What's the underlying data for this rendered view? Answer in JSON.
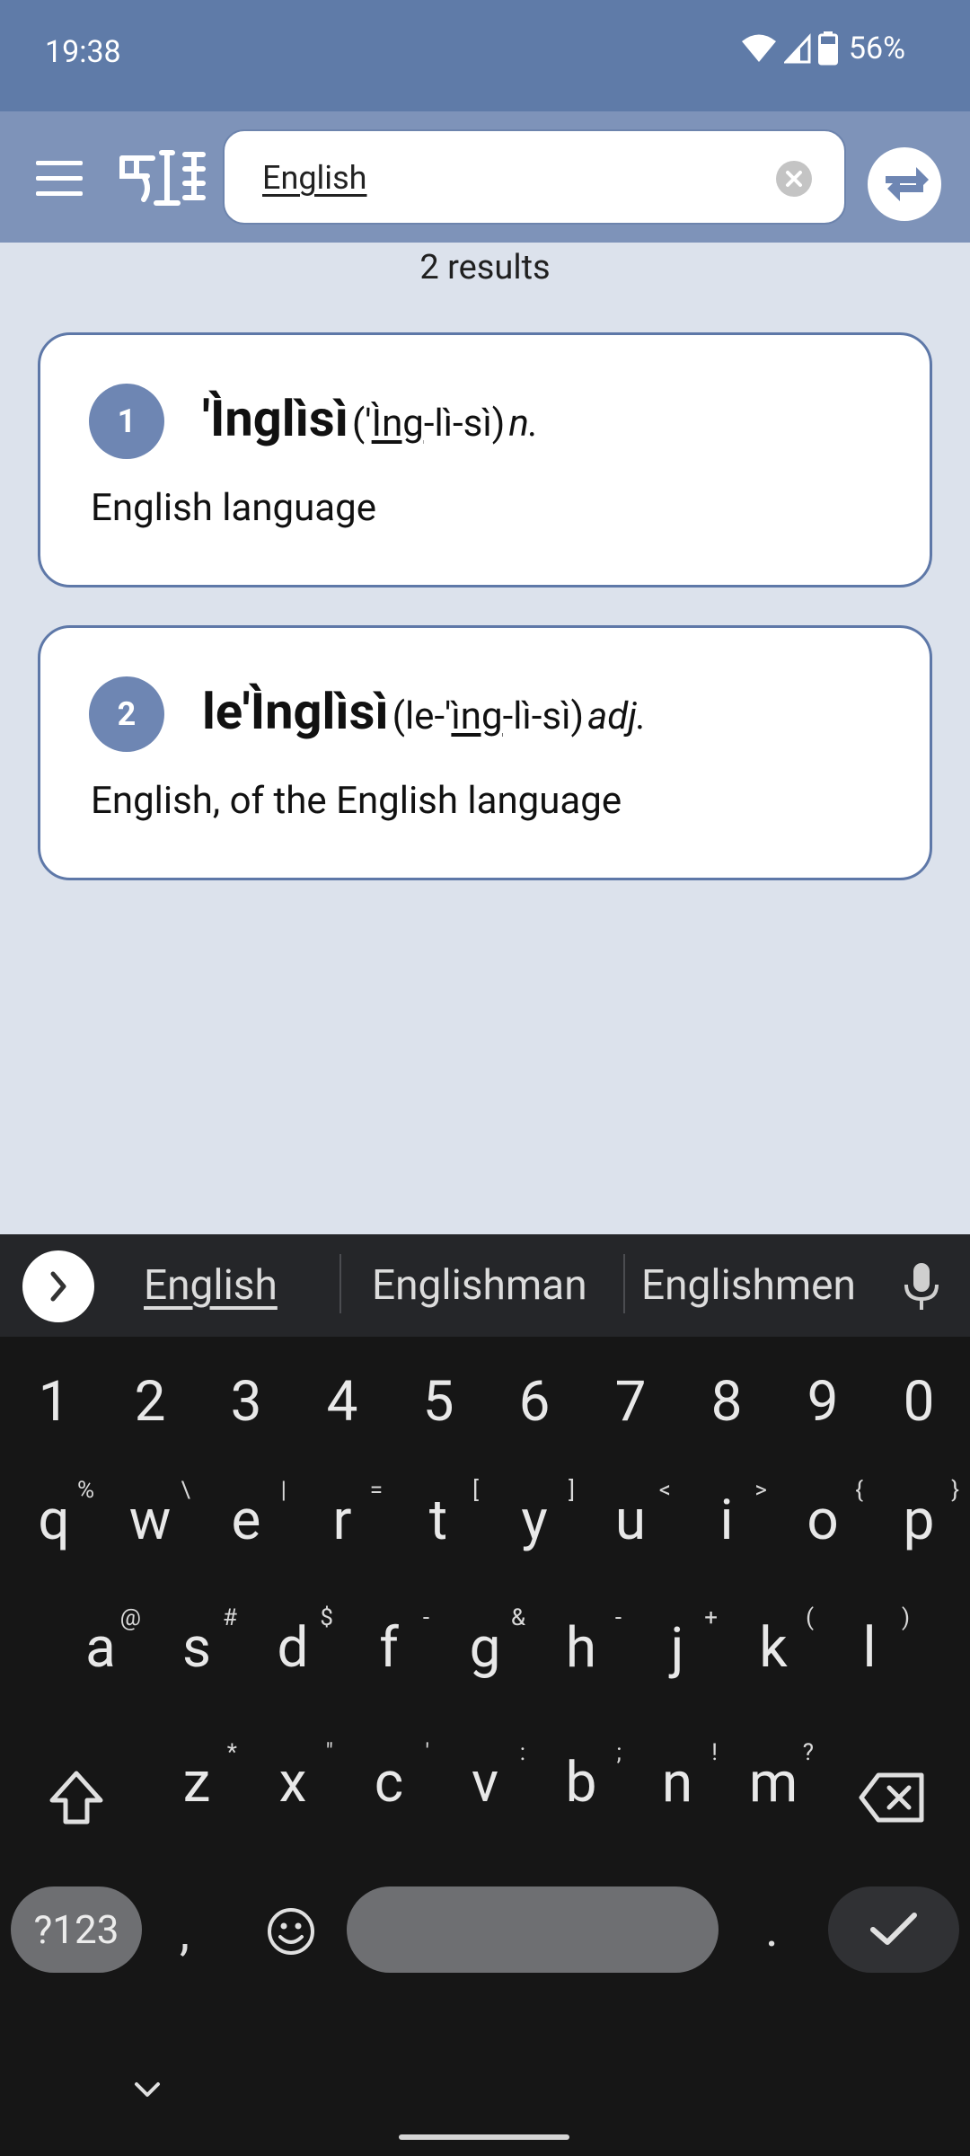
{
  "status": {
    "time": "19:38",
    "battery_pct": "56%"
  },
  "search": {
    "value": "English"
  },
  "results": {
    "count_text": "2 results",
    "items": [
      {
        "num": "1",
        "headword": "'Ìnglìsì",
        "pron_open": "('",
        "pron_u": "Ìng",
        "pron_rest": "-lì-sì)",
        "pos": "n.",
        "definition": "English language"
      },
      {
        "num": "2",
        "headword": "le'Ìnglìsì",
        "pron_open": "(le-'",
        "pron_u": "ìng",
        "pron_rest": "-lì-sì)",
        "pos": "adj.",
        "definition": "English, of the English language"
      }
    ]
  },
  "keyboard": {
    "suggestions": [
      "English",
      "Englishman",
      "Englishmen"
    ],
    "numbers": [
      "1",
      "2",
      "3",
      "4",
      "5",
      "6",
      "7",
      "8",
      "9",
      "0"
    ],
    "row1": [
      {
        "k": "q",
        "h": "%"
      },
      {
        "k": "w",
        "h": "\\"
      },
      {
        "k": "e",
        "h": "|"
      },
      {
        "k": "r",
        "h": "="
      },
      {
        "k": "t",
        "h": "["
      },
      {
        "k": "y",
        "h": "]"
      },
      {
        "k": "u",
        "h": "<"
      },
      {
        "k": "i",
        "h": ">"
      },
      {
        "k": "o",
        "h": "{"
      },
      {
        "k": "p",
        "h": "}"
      }
    ],
    "row2": [
      {
        "k": "a",
        "h": "@"
      },
      {
        "k": "s",
        "h": "#"
      },
      {
        "k": "d",
        "h": "$"
      },
      {
        "k": "f",
        "h": "-"
      },
      {
        "k": "g",
        "h": "&"
      },
      {
        "k": "h",
        "h": "-"
      },
      {
        "k": "j",
        "h": "+"
      },
      {
        "k": "k",
        "h": "("
      },
      {
        "k": "l",
        "h": ")"
      }
    ],
    "row3": [
      {
        "k": "z",
        "h": "*"
      },
      {
        "k": "x",
        "h": "\""
      },
      {
        "k": "c",
        "h": "'"
      },
      {
        "k": "v",
        "h": ":"
      },
      {
        "k": "b",
        "h": ";"
      },
      {
        "k": "n",
        "h": "!"
      },
      {
        "k": "m",
        "h": "?"
      }
    ],
    "symbols_label": "?123",
    "comma": ",",
    "period": "."
  }
}
